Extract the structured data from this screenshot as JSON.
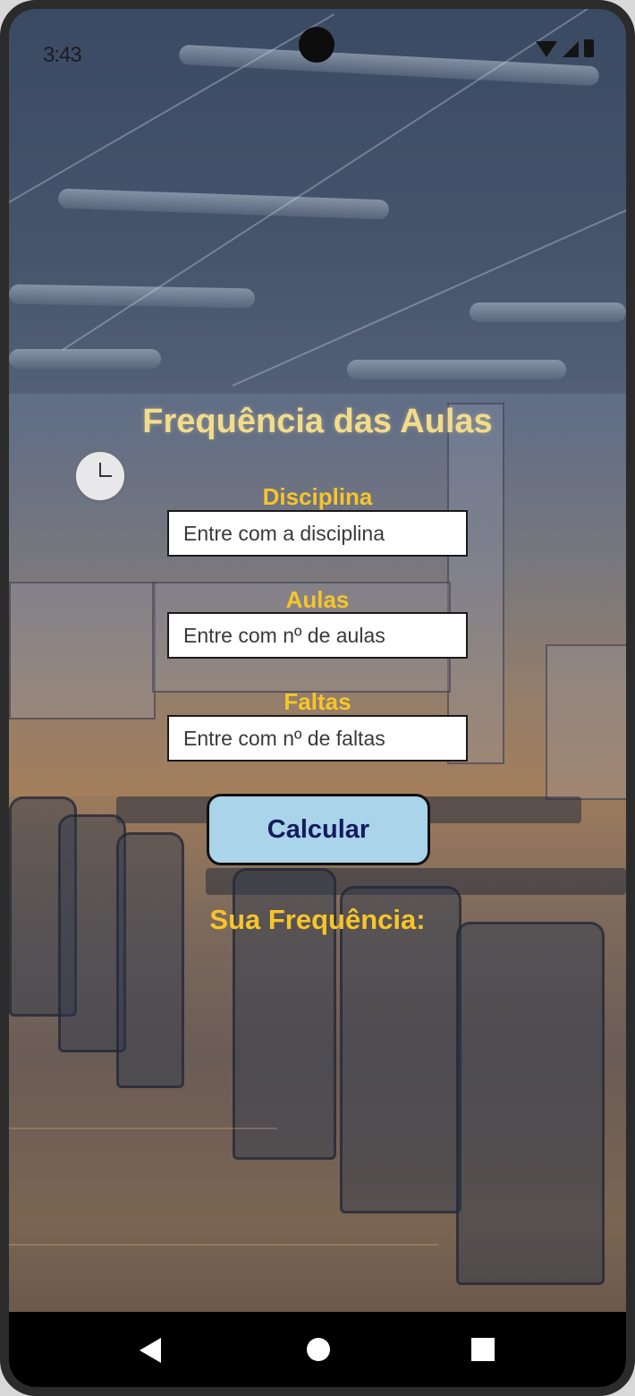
{
  "status_bar": {
    "time": "3:43",
    "icons": [
      "wifi-icon",
      "signal-icon",
      "battery-icon"
    ]
  },
  "app": {
    "title": "Frequência das Aulas",
    "fields": [
      {
        "label": "Disciplina",
        "placeholder": "Entre com a disciplina",
        "value": ""
      },
      {
        "label": "Aulas",
        "placeholder": "Entre com nº de aulas",
        "value": ""
      },
      {
        "label": "Faltas",
        "placeholder": "Entre com nº de faltas",
        "value": ""
      }
    ],
    "calculate_label": "Calcular",
    "result_label": "Sua Frequência:"
  },
  "nav_bar": {
    "icons": [
      "back-icon",
      "home-icon",
      "recent-apps-icon"
    ]
  },
  "colors": {
    "title": "#f2dc8c",
    "labels": "#f7c52a",
    "button_bg": "#a9d4ea",
    "button_text": "#141b5e"
  }
}
